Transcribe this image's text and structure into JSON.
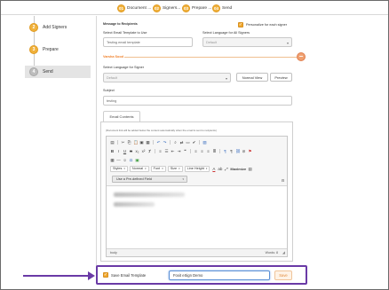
{
  "steps": [
    {
      "num": "01",
      "label": "Document ..."
    },
    {
      "num": "02",
      "label": "Signers..."
    },
    {
      "num": "03",
      "label": "Prepare ..."
    },
    {
      "num": "04",
      "label": "Send"
    }
  ],
  "sidebar": {
    "items": [
      {
        "num": "2",
        "label": "Add Signers"
      },
      {
        "num": "3",
        "label": "Prepare"
      },
      {
        "num": "4",
        "label": "Send"
      }
    ]
  },
  "message": {
    "heading": "Message to Recipients",
    "personalize_label": "Personalize for each signer",
    "template_label": "Select Email Template to Use",
    "template_value": "Testing email template",
    "language_all_label": "Select Language for All Signers",
    "language_all_value": "Default",
    "signer_name": "Varsha Sood",
    "language_signer_label": "Select Language for Signer",
    "language_signer_value": "Default",
    "normal_view_btn": "Normal View",
    "preview_btn": "Preview",
    "subject_label": "Subject",
    "subject_value": "testing",
    "tab_email_contents": "Email Contents",
    "hint": "(Document link will be added below the content automatically when the email is sent to recipients)"
  },
  "editor": {
    "styles": "Styles",
    "normal": "Normal",
    "font": "Font",
    "size": "Size",
    "line_height": "Line Height",
    "maximize": "Maximize",
    "predefined_field": "Use a Pre-defined Field",
    "status_left": "body",
    "status_right": "Words: 8"
  },
  "save_template": {
    "checkbox_label": "Save Email Template",
    "name_value": "Foxit eSign Demo",
    "save_btn": "Save"
  },
  "colors": {
    "accent_orange": "#f0b13b",
    "highlight_purple": "#6a3aa6"
  }
}
